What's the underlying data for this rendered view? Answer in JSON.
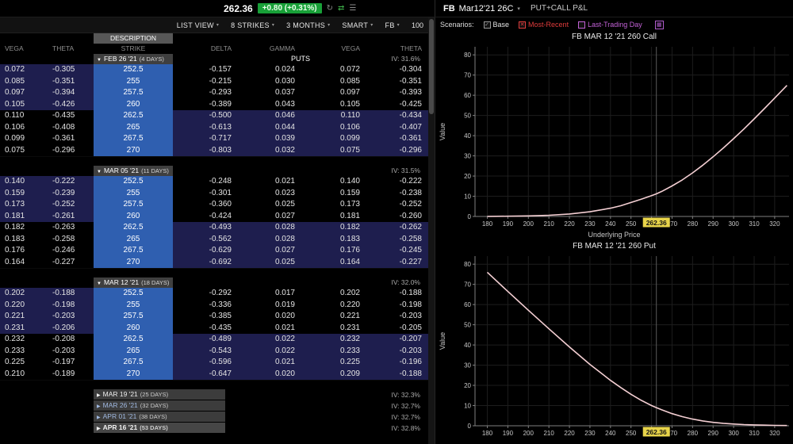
{
  "topbar": {
    "last_price": "262.36",
    "change": "+0.80 (+0.31%)",
    "right": {
      "symbol": "FB",
      "contract": "Mar12'21 26C",
      "plot_label": "PUT+CALL P&L"
    }
  },
  "toolbar": {
    "items": [
      "LIST VIEW",
      "8 STRIKES",
      "3 MONTHS",
      "SMART",
      "FB"
    ],
    "size": "100"
  },
  "scenarios": {
    "label": "Scenarios:",
    "items": [
      {
        "label": "Base",
        "checked": true,
        "color": "#e0e0e0",
        "box": "#999999",
        "mark": "✓"
      },
      {
        "label": "Most-Recent",
        "checked": true,
        "color": "#e03c3c",
        "box": "#e03c3c",
        "mark": "✕"
      },
      {
        "label": "Last-Trading Day",
        "checked": false,
        "color": "#c261d6",
        "box": "#c261d6",
        "mark": ""
      }
    ]
  },
  "table": {
    "description_label": "DESCRIPTION",
    "puts_label": "PUTS",
    "col_headers": [
      "VEGA",
      "THETA",
      "STRIKE",
      "DELTA",
      "GAMMA",
      "VEGA",
      "THETA"
    ],
    "colors": {
      "strike_bg": "#2f5fb0",
      "itm_bg": "#1e1e4e"
    },
    "groups": [
      {
        "name": "FEB 26 '21",
        "days": "(4 DAYS)",
        "iv": "IV: 31.6%",
        "expanded": true,
        "rows": [
          [
            "0.072",
            "-0.305",
            "252.5",
            "-0.157",
            "0.024",
            "0.072",
            "-0.304"
          ],
          [
            "0.085",
            "-0.351",
            "255",
            "-0.215",
            "0.030",
            "0.085",
            "-0.351"
          ],
          [
            "0.097",
            "-0.394",
            "257.5",
            "-0.293",
            "0.037",
            "0.097",
            "-0.393"
          ],
          [
            "0.105",
            "-0.426",
            "260",
            "-0.389",
            "0.043",
            "0.105",
            "-0.425"
          ],
          [
            "0.110",
            "-0.435",
            "262.5",
            "-0.500",
            "0.046",
            "0.110",
            "-0.434"
          ],
          [
            "0.106",
            "-0.408",
            "265",
            "-0.613",
            "0.044",
            "0.106",
            "-0.407"
          ],
          [
            "0.099",
            "-0.361",
            "267.5",
            "-0.717",
            "0.039",
            "0.099",
            "-0.361"
          ],
          [
            "0.075",
            "-0.296",
            "270",
            "-0.803",
            "0.032",
            "0.075",
            "-0.296"
          ]
        ]
      },
      {
        "name": "MAR 05 '21",
        "days": "(11 DAYS)",
        "iv": "IV: 31.5%",
        "expanded": true,
        "rows": [
          [
            "0.140",
            "-0.222",
            "252.5",
            "-0.248",
            "0.021",
            "0.140",
            "-0.222"
          ],
          [
            "0.159",
            "-0.239",
            "255",
            "-0.301",
            "0.023",
            "0.159",
            "-0.238"
          ],
          [
            "0.173",
            "-0.252",
            "257.5",
            "-0.360",
            "0.025",
            "0.173",
            "-0.252"
          ],
          [
            "0.181",
            "-0.261",
            "260",
            "-0.424",
            "0.027",
            "0.181",
            "-0.260"
          ],
          [
            "0.182",
            "-0.263",
            "262.5",
            "-0.493",
            "0.028",
            "0.182",
            "-0.262"
          ],
          [
            "0.183",
            "-0.258",
            "265",
            "-0.562",
            "0.028",
            "0.183",
            "-0.258"
          ],
          [
            "0.176",
            "-0.246",
            "267.5",
            "-0.629",
            "0.027",
            "0.176",
            "-0.245"
          ],
          [
            "0.164",
            "-0.227",
            "270",
            "-0.692",
            "0.025",
            "0.164",
            "-0.227"
          ]
        ]
      },
      {
        "name": "MAR 12 '21",
        "days": "(18 DAYS)",
        "iv": "IV: 32.0%",
        "expanded": true,
        "rows": [
          [
            "0.202",
            "-0.188",
            "252.5",
            "-0.292",
            "0.017",
            "0.202",
            "-0.188"
          ],
          [
            "0.220",
            "-0.198",
            "255",
            "-0.336",
            "0.019",
            "0.220",
            "-0.198"
          ],
          [
            "0.221",
            "-0.203",
            "257.5",
            "-0.385",
            "0.020",
            "0.221",
            "-0.203"
          ],
          [
            "0.231",
            "-0.206",
            "260",
            "-0.435",
            "0.021",
            "0.231",
            "-0.205"
          ],
          [
            "0.232",
            "-0.208",
            "262.5",
            "-0.489",
            "0.022",
            "0.232",
            "-0.207"
          ],
          [
            "0.233",
            "-0.203",
            "265",
            "-0.543",
            "0.022",
            "0.233",
            "-0.203"
          ],
          [
            "0.225",
            "-0.197",
            "267.5",
            "-0.596",
            "0.021",
            "0.225",
            "-0.196"
          ],
          [
            "0.210",
            "-0.189",
            "270",
            "-0.647",
            "0.020",
            "0.209",
            "-0.188"
          ]
        ]
      }
    ],
    "collapsed": [
      {
        "name": "MAR 19 '21",
        "days": "(25 DAYS)",
        "iv": "IV: 32.3%",
        "tint": false,
        "bold": false
      },
      {
        "name": "MAR 26 '21",
        "days": "(32 DAYS)",
        "iv": "IV: 32.7%",
        "tint": true,
        "bold": false
      },
      {
        "name": "APR 01 '21",
        "days": "(38 DAYS)",
        "iv": "IV: 32.7%",
        "tint": true,
        "bold": false
      },
      {
        "name": "APR 16 '21",
        "days": "(53 DAYS)",
        "iv": "IV: 32.8%",
        "tint": false,
        "bold": true
      }
    ]
  },
  "chart_data": [
    {
      "type": "line",
      "title": "FB MAR 12 '21 260 Call",
      "xlabel": "Underlying Price",
      "ylabel": "Value",
      "xlim": [
        174,
        327
      ],
      "ylim": [
        0,
        84
      ],
      "xticks": [
        180,
        190,
        200,
        210,
        220,
        230,
        240,
        250,
        260,
        270,
        280,
        290,
        300,
        310,
        320
      ],
      "yticks": [
        0,
        10,
        20,
        30,
        40,
        50,
        60,
        70,
        80
      ],
      "crosshair_x": 262.36,
      "crosshair_label": "262.36",
      "line_color": "#f4cfd3",
      "crosshair_tag_color": "#e8d44a",
      "x": [
        180,
        190,
        200,
        210,
        220,
        230,
        240,
        245,
        250,
        255,
        260,
        262.36,
        265,
        270,
        275,
        280,
        285,
        290,
        295,
        300,
        305,
        310,
        315,
        320,
        326
      ],
      "values": [
        0.05,
        0.12,
        0.28,
        0.6,
        1.2,
        2.3,
        4.1,
        5.3,
        6.9,
        8.5,
        10.3,
        11.2,
        12.4,
        15.1,
        18.1,
        21.6,
        25.4,
        29.5,
        33.9,
        38.5,
        43.3,
        48.3,
        53.4,
        58.6,
        64.9
      ]
    },
    {
      "type": "line",
      "title": "FB MAR 12 '21 260 Put",
      "xlabel": "",
      "ylabel": "Value",
      "xlim": [
        174,
        327
      ],
      "ylim": [
        0,
        84
      ],
      "xticks": [
        180,
        190,
        200,
        210,
        220,
        230,
        240,
        250,
        260,
        270,
        280,
        290,
        300,
        310,
        320
      ],
      "yticks": [
        0,
        10,
        20,
        30,
        40,
        50,
        60,
        70,
        80
      ],
      "crosshair_x": 262.36,
      "crosshair_label": "262.36",
      "line_color": "#f4cfd3",
      "crosshair_tag_color": "#e8d44a",
      "x": [
        180,
        190,
        200,
        210,
        220,
        230,
        240,
        245,
        250,
        255,
        260,
        262.36,
        265,
        270,
        275,
        280,
        285,
        290,
        295,
        300,
        305,
        310,
        315,
        320,
        326
      ],
      "values": [
        76.0,
        66.5,
        57.2,
        48.0,
        39.0,
        30.4,
        22.5,
        18.9,
        15.6,
        12.6,
        10.0,
        9.0,
        7.9,
        6.0,
        4.5,
        3.3,
        2.4,
        1.7,
        1.2,
        0.85,
        0.6,
        0.42,
        0.3,
        0.2,
        0.12
      ]
    }
  ]
}
